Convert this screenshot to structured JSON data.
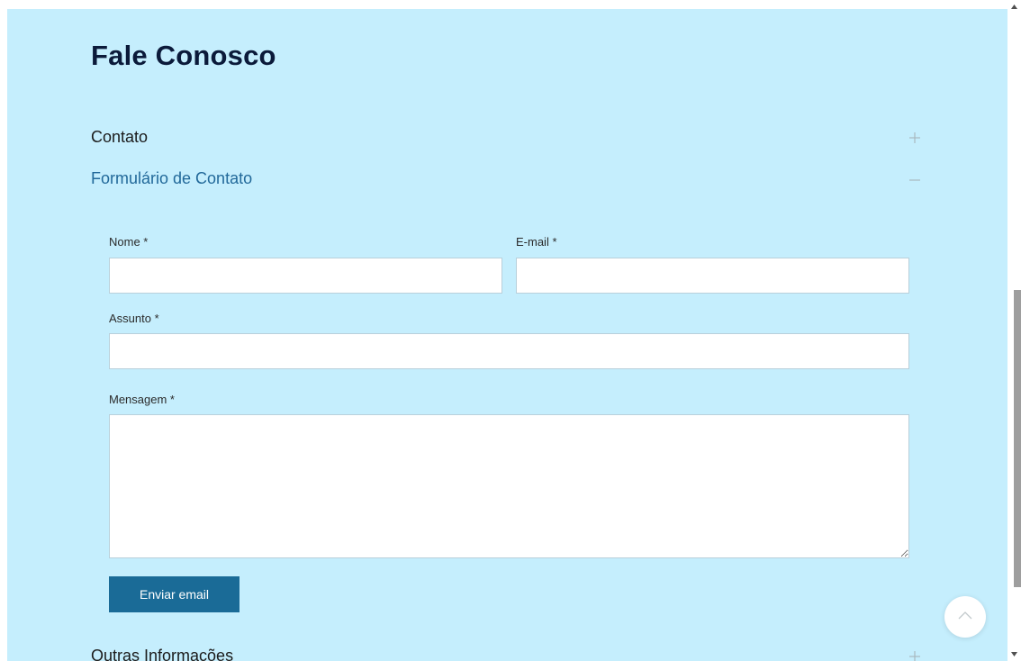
{
  "page": {
    "title": "Fale Conosco"
  },
  "accordion": {
    "sections": [
      {
        "label": "Contato",
        "state": "collapsed",
        "icon": "plus-icon"
      },
      {
        "label": "Formulário de Contato",
        "state": "expanded",
        "icon": "minus-icon"
      },
      {
        "label": "Outras Informações",
        "state": "collapsed",
        "icon": "plus-icon"
      }
    ]
  },
  "form": {
    "name_label": "Nome *",
    "name_value": "",
    "email_label": "E-mail *",
    "email_value": "",
    "subject_label": "Assunto *",
    "subject_value": "",
    "message_label": "Mensagem *",
    "message_value": "",
    "submit_label": "Enviar email"
  },
  "colors": {
    "page_background": "#c5eefd",
    "title": "#0b1a3a",
    "active_section": "#22699a",
    "button": "#1a6b97",
    "field_border": "#b9d0db"
  },
  "icons": {
    "back_to_top": "chevron-up-icon"
  }
}
